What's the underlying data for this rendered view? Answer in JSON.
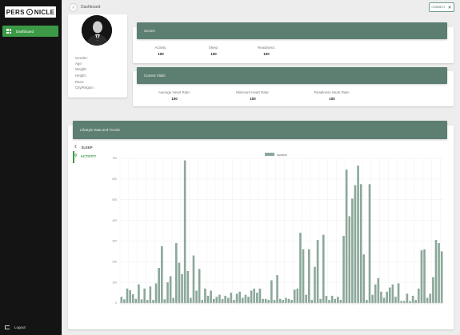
{
  "sidebar": {
    "logo_text": "PERS NICLE",
    "logo_left": "PERS",
    "logo_right": "NICLE",
    "items": [
      {
        "label": "Dashboard",
        "icon": "grid-icon"
      }
    ],
    "logout_label": "Logout",
    "active_color": "#3c9a47"
  },
  "topbar": {
    "breadcrumb": "Dashboard",
    "connect_label": "CONNECT"
  },
  "profile": {
    "fields": [
      "Gender:",
      "Age:",
      "Weight:",
      "Height:",
      "Race:",
      "City/Region:"
    ]
  },
  "scores": {
    "title": "Scores",
    "items": [
      {
        "label": "Activity:",
        "value": "100"
      },
      {
        "label": "Sleep:",
        "value": "100"
      },
      {
        "label": "Readiness:",
        "value": "100"
      }
    ]
  },
  "vitals": {
    "title": "Current Vitals",
    "items": [
      {
        "label": "Average Heart Rate:",
        "value": "100"
      },
      {
        "label": "Minimum Heart Rate:",
        "value": "100"
      },
      {
        "label": "Readiness Heart Rate:",
        "value": "100"
      }
    ]
  },
  "lifestyle": {
    "title": "Lifestyle Data and Trends",
    "tabs": [
      {
        "label": "SLEEP",
        "icon": "moon-icon",
        "active": false
      },
      {
        "label": "ACTIVITY",
        "icon": "walk-icon",
        "active": true
      }
    ]
  },
  "chart_data": {
    "type": "bar",
    "series_name": "duration",
    "color": "#8ba89a",
    "ylim": [
      0,
      700
    ],
    "yticks": [
      0,
      100,
      200,
      300,
      400,
      500,
      600,
      700
    ],
    "values": [
      30,
      18,
      70,
      62,
      42,
      20,
      90,
      18,
      70,
      15,
      80,
      15,
      95,
      170,
      275,
      18,
      100,
      130,
      25,
      290,
      195,
      140,
      690,
      155,
      25,
      230,
      60,
      165,
      15,
      70,
      35,
      60,
      20,
      30,
      40,
      20,
      35,
      25,
      50,
      15,
      45,
      55,
      25,
      40,
      30,
      60,
      70,
      50,
      70,
      20,
      20,
      15,
      110,
      15,
      135,
      20,
      15,
      25,
      20,
      15,
      65,
      70,
      340,
      260,
      40,
      260,
      15,
      175,
      305,
      20,
      330,
      35,
      15,
      35,
      20,
      30,
      15,
      325,
      645,
      420,
      505,
      570,
      665,
      575,
      235,
      15,
      575,
      40,
      90,
      120,
      55,
      25,
      55,
      75,
      90,
      30,
      95,
      10,
      10,
      45,
      10,
      35,
      15,
      70,
      255,
      260,
      25,
      45,
      125,
      305,
      290,
      250
    ]
  },
  "legend_label": "duration"
}
